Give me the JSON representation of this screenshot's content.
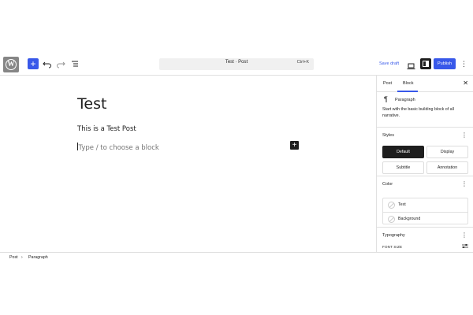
{
  "toolbar": {
    "add_icon": "plus-icon",
    "document_title": "Test · Post",
    "shortcut": "Ctrl+K",
    "save_draft": "Save draft",
    "publish": "Publish"
  },
  "editor": {
    "title": "Test",
    "paragraph": "This is a Test Post",
    "placeholder": "Type / to choose a block"
  },
  "sidebar": {
    "tabs": [
      "Post",
      "Block"
    ],
    "active_tab": "Block",
    "block": {
      "name": "Paragraph",
      "description": "Start with the basic building block of all narrative."
    },
    "styles": {
      "heading": "Styles",
      "options": [
        "Default",
        "Display",
        "Subtitle",
        "Annotation"
      ],
      "selected": "Default"
    },
    "color": {
      "heading": "Color",
      "items": [
        "Text",
        "Background"
      ]
    },
    "typography": {
      "heading": "Typography",
      "font_size_label": "FONT SIZE"
    }
  },
  "breadcrumb": [
    "Post",
    "Paragraph"
  ],
  "colors": {
    "accent": "#3858e9",
    "dark": "#1e1e1e"
  }
}
